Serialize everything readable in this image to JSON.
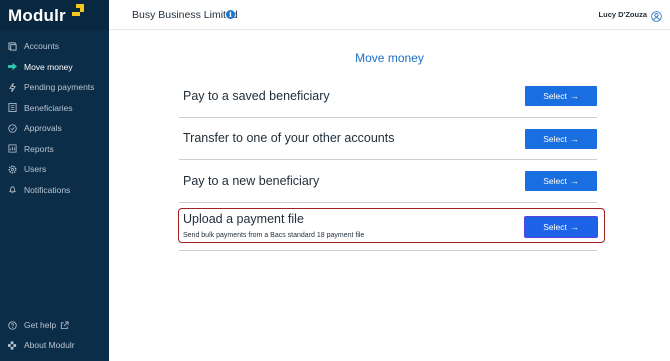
{
  "brand": {
    "name": "Modulr"
  },
  "sidebar": {
    "items": [
      {
        "label": "Accounts",
        "icon": "accounts-icon",
        "active": false
      },
      {
        "label": "Move money",
        "icon": "arrow-right-icon",
        "active": true
      },
      {
        "label": "Pending payments",
        "icon": "lightning-icon",
        "active": false
      },
      {
        "label": "Beneficiaries",
        "icon": "list-icon",
        "active": false
      },
      {
        "label": "Approvals",
        "icon": "check-circle-icon",
        "active": false
      },
      {
        "label": "Reports",
        "icon": "reports-icon",
        "active": false
      },
      {
        "label": "Users",
        "icon": "gear-icon",
        "active": false
      },
      {
        "label": "Notifications",
        "icon": "bell-icon",
        "active": false
      }
    ],
    "bottom": [
      {
        "label": "Get help",
        "icon": "help-icon"
      },
      {
        "label": "About Modulr",
        "icon": "modulr-icon"
      }
    ]
  },
  "header": {
    "company": "Busy Business Limited",
    "user": "Lucy D'Zouza"
  },
  "main": {
    "title": "Move money",
    "options": [
      {
        "title": "Pay to a saved beneficiary",
        "subtitle": "",
        "button": "Select"
      },
      {
        "title": "Transfer to one of your other accounts",
        "subtitle": "",
        "button": "Select"
      },
      {
        "title": "Pay to a new beneficiary",
        "subtitle": "",
        "button": "Select"
      },
      {
        "title": "Upload a payment file",
        "subtitle": "Send bulk payments from a Bacs standard 18 payment file",
        "button": "Select"
      }
    ]
  },
  "colors": {
    "sidebar": "#0c2d48",
    "accent": "#1a6fe0",
    "brand_mark": "#f5c81e",
    "highlight": "#a02020",
    "active_icon": "#33c9b0"
  }
}
